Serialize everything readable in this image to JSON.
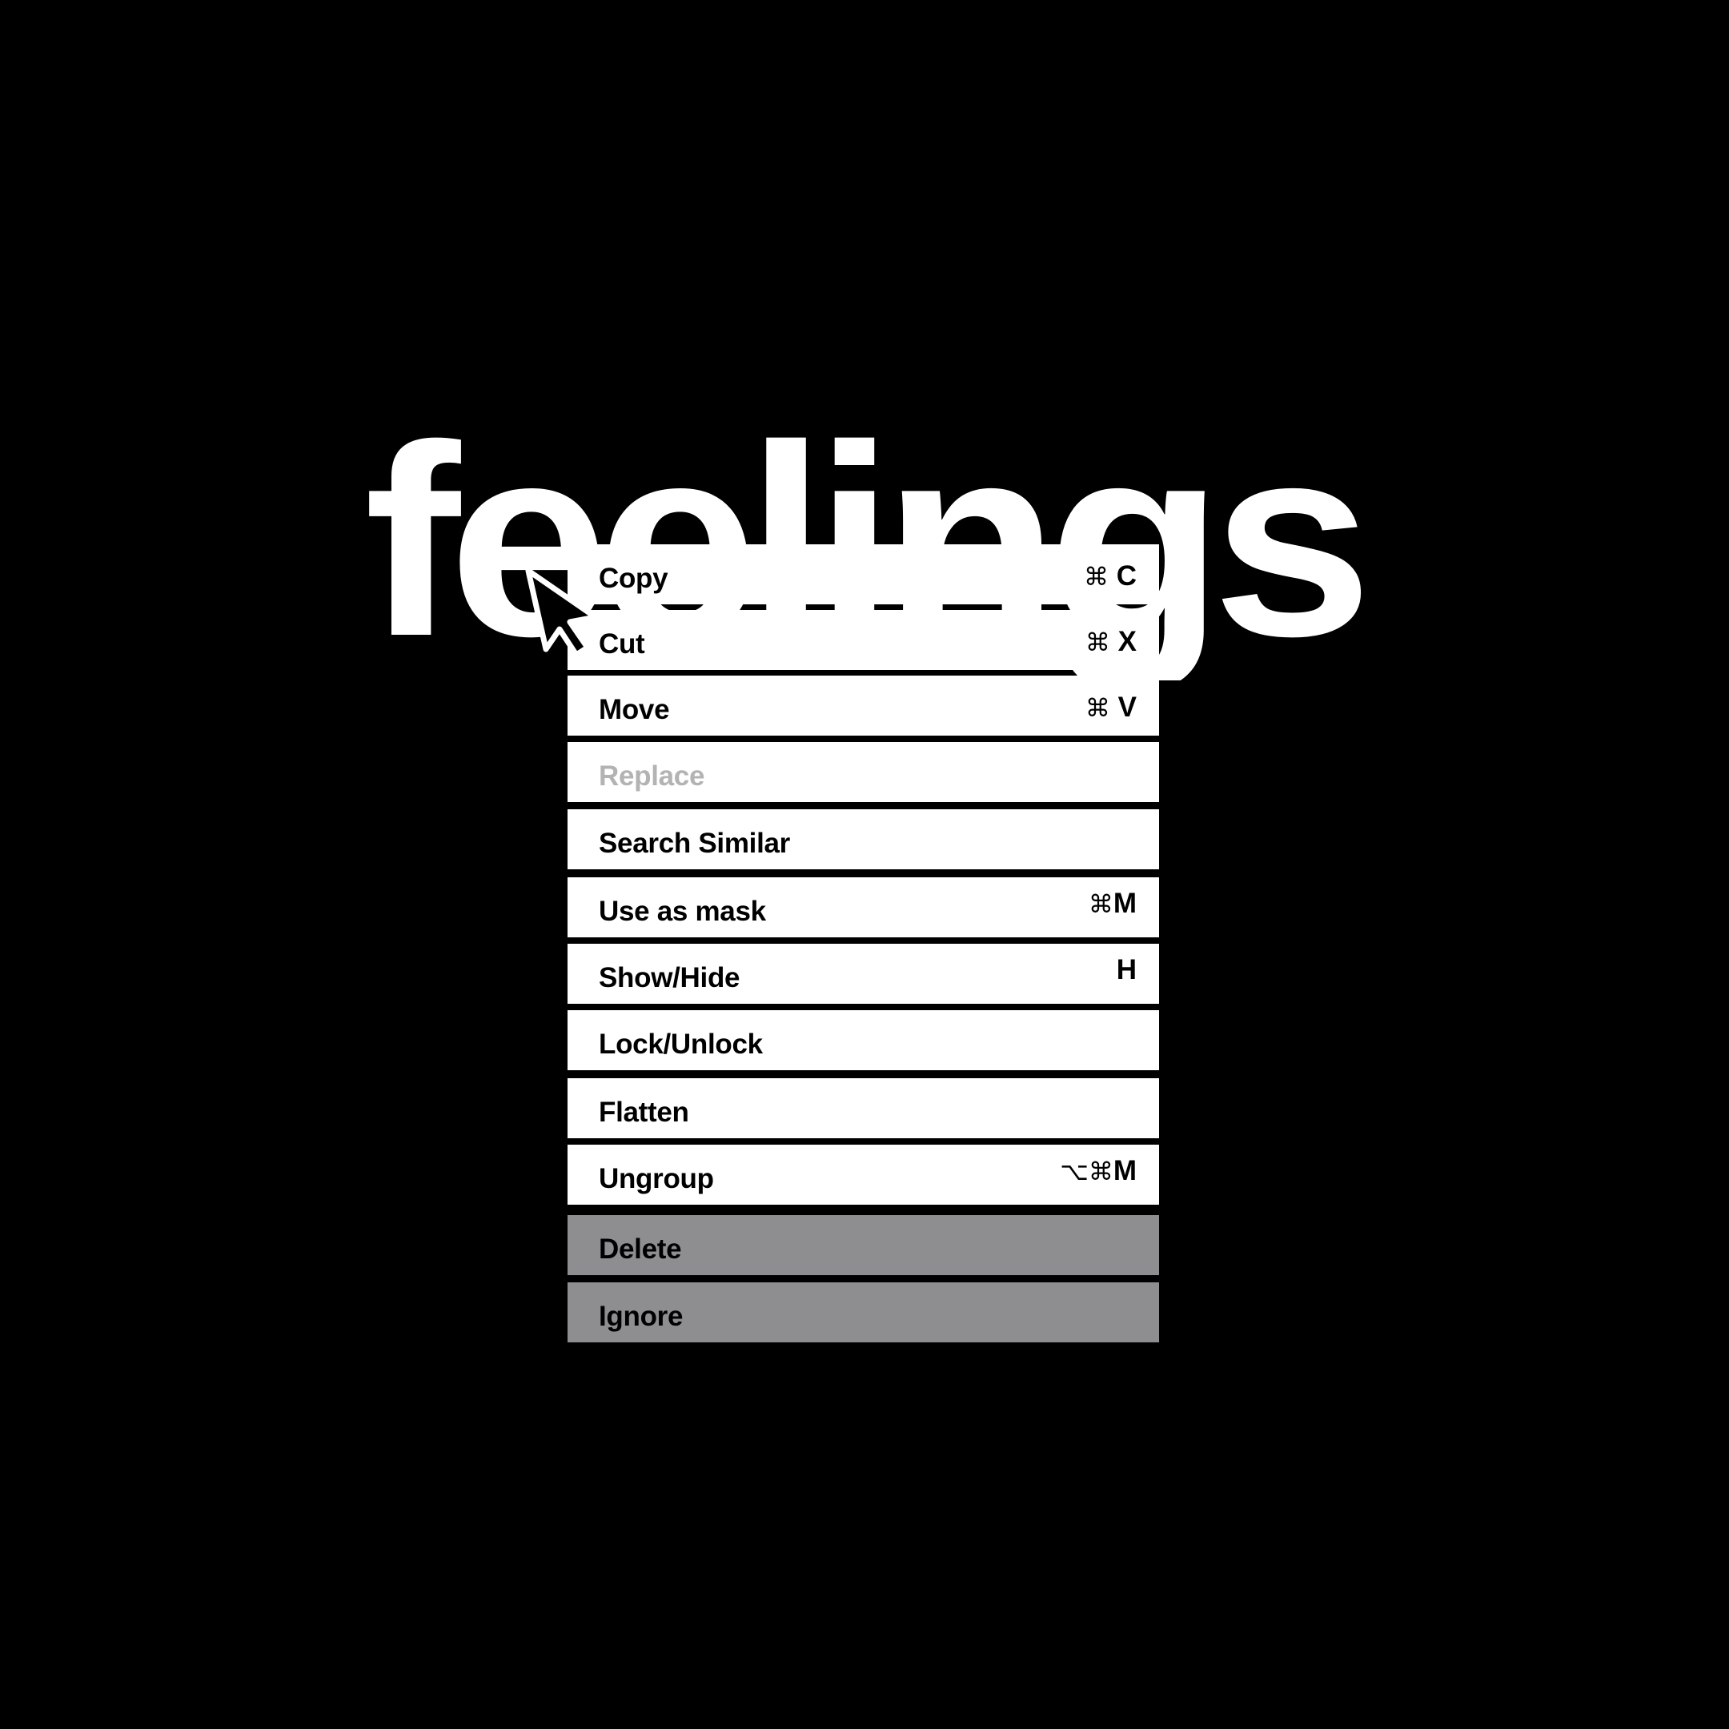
{
  "headline": "feelings",
  "menu": {
    "items": [
      {
        "label": "Copy",
        "cmd": "⌘",
        "key": "C",
        "state": "normal"
      },
      {
        "label": "Cut",
        "cmd": "⌘",
        "key": "X",
        "state": "normal"
      },
      {
        "label": "Move",
        "cmd": "⌘",
        "key": "V",
        "state": "normal"
      },
      {
        "label": "Replace",
        "state": "disabled"
      },
      {
        "label": "Search Similar",
        "state": "normal"
      },
      {
        "label": "Use as mask",
        "cmd": "⌘",
        "key": "M",
        "state": "normal"
      },
      {
        "label": "Show/Hide",
        "key": "H",
        "state": "normal"
      },
      {
        "label": "Lock/Unlock",
        "state": "normal"
      },
      {
        "label": "Flatten",
        "state": "normal"
      },
      {
        "label": "Ungroup",
        "cmd": "⌥⌘",
        "key": "M",
        "state": "normal"
      },
      {
        "label": "Delete",
        "state": "destructive"
      },
      {
        "label": "Ignore",
        "state": "destructive"
      }
    ]
  },
  "colors": {
    "background": "#000000",
    "item": "#ffffff",
    "destructive_item": "#8e8e91",
    "disabled_text": "#b3b3b3",
    "text": "#000000"
  },
  "icons": {
    "pointer": "arrow-cursor-icon"
  }
}
